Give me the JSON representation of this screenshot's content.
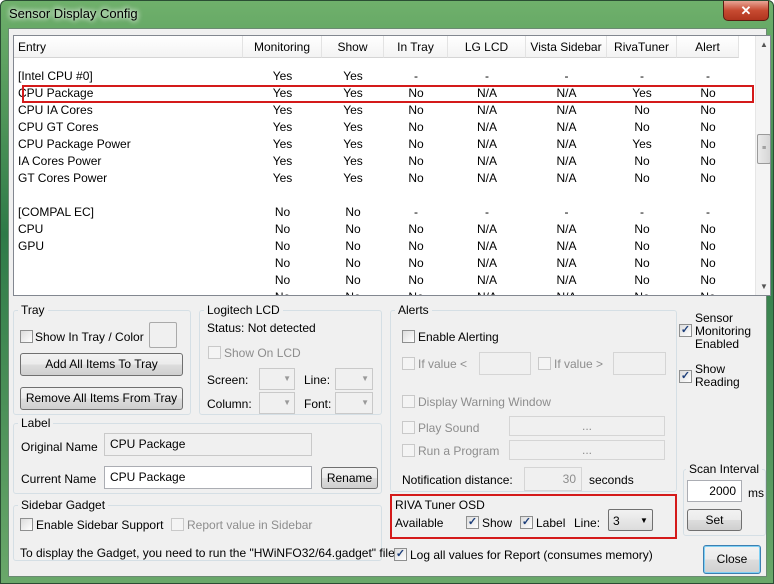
{
  "window": {
    "title": "Sensor Display Config",
    "close_glyph": "✕"
  },
  "table": {
    "columns": [
      "Entry",
      "Monitoring",
      "Show",
      "In Tray",
      "LG LCD",
      "Vista Sidebar",
      "RivaTuner",
      "Alert"
    ],
    "rows": [
      [
        "[Intel CPU #0]",
        "Yes",
        "Yes",
        "-",
        "-",
        "-",
        "-",
        "-"
      ],
      [
        "CPU Package",
        "Yes",
        "Yes",
        "No",
        "N/A",
        "N/A",
        "Yes",
        "No"
      ],
      [
        "CPU IA Cores",
        "Yes",
        "Yes",
        "No",
        "N/A",
        "N/A",
        "No",
        "No"
      ],
      [
        "CPU GT Cores",
        "Yes",
        "Yes",
        "No",
        "N/A",
        "N/A",
        "No",
        "No"
      ],
      [
        "CPU Package Power",
        "Yes",
        "Yes",
        "No",
        "N/A",
        "N/A",
        "Yes",
        "No"
      ],
      [
        "IA Cores Power",
        "Yes",
        "Yes",
        "No",
        "N/A",
        "N/A",
        "No",
        "No"
      ],
      [
        "GT Cores Power",
        "Yes",
        "Yes",
        "No",
        "N/A",
        "N/A",
        "No",
        "No"
      ],
      [
        "",
        "",
        "",
        "",
        "",
        "",
        "",
        ""
      ],
      [
        "[COMPAL EC]",
        "No",
        "No",
        "-",
        "-",
        "-",
        "-",
        "-"
      ],
      [
        "CPU",
        "No",
        "No",
        "No",
        "N/A",
        "N/A",
        "No",
        "No"
      ],
      [
        "GPU",
        "No",
        "No",
        "No",
        "N/A",
        "N/A",
        "No",
        "No"
      ],
      [
        "",
        "No",
        "No",
        "No",
        "N/A",
        "N/A",
        "No",
        "No"
      ],
      [
        "",
        "No",
        "No",
        "No",
        "N/A",
        "N/A",
        "No",
        "No"
      ],
      [
        "",
        "No",
        "No",
        "No",
        "N/A",
        "N/A",
        "No",
        "No"
      ],
      [
        "",
        "No",
        "No",
        "No",
        "N/A",
        "N/A",
        "No",
        "No"
      ]
    ],
    "selected_row": 1
  },
  "tray": {
    "title": "Tray",
    "show_label": "Show In Tray / Color",
    "add_all": "Add All Items To Tray",
    "remove_all": "Remove All Items From Tray"
  },
  "lcd": {
    "title": "Logitech LCD",
    "status": "Status: Not detected",
    "show_on_lcd": "Show On LCD",
    "screen": "Screen:",
    "line": "Line:",
    "column": "Column:",
    "font": "Font:"
  },
  "alerts": {
    "title": "Alerts",
    "enable": "Enable Alerting",
    "if_less": "If value <",
    "if_greater": "If value >",
    "display_warning": "Display Warning Window",
    "play_sound": "Play Sound",
    "run_program": "Run a Program",
    "browse": "...",
    "notif_label": "Notification distance:",
    "notif_value": "30",
    "seconds": "seconds"
  },
  "label": {
    "title": "Label",
    "original_label": "Original Name",
    "original_value": "CPU Package",
    "current_label": "Current Name",
    "current_value": "CPU Package",
    "rename": "Rename"
  },
  "gadget": {
    "title": "Sidebar Gadget",
    "enable": "Enable Sidebar Support",
    "report": "Report value in Sidebar",
    "info": "To display the Gadget, you need to run the \"HWiNFO32/64.gadget\" file."
  },
  "riva": {
    "title": "RIVA Tuner OSD",
    "available": "Available",
    "show": "Show",
    "label": "Label",
    "line": "Line:",
    "line_value": "3"
  },
  "sensor": {
    "monitoring": "Sensor Monitoring Enabled",
    "show_reading": "Show Reading"
  },
  "scan": {
    "title": "Scan Interval",
    "value": "2000",
    "unit": "ms",
    "set": "Set"
  },
  "log": {
    "label": "Log all values for Report (consumes memory)"
  },
  "close": {
    "label": "Close"
  }
}
